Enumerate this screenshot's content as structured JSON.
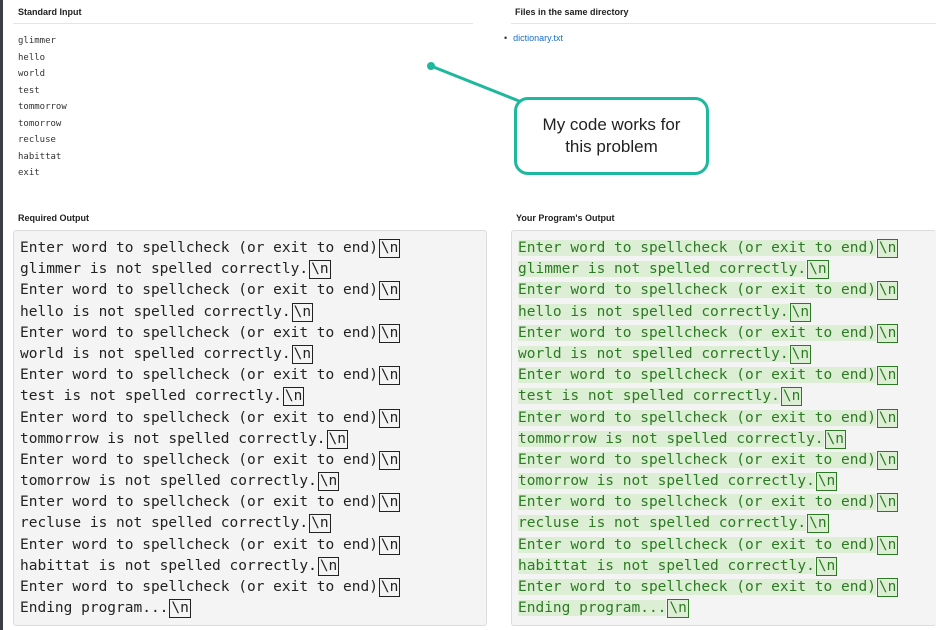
{
  "standard_input": {
    "title": "Standard Input",
    "lines": [
      "glimmer",
      "hello",
      "world",
      "test",
      "tommorrow",
      "tomorrow",
      "recluse",
      "habittat",
      "exit"
    ]
  },
  "files": {
    "title": "Files in the same directory",
    "items": [
      "dictionary.txt"
    ]
  },
  "annotation": {
    "text_line1": "My code works for",
    "text_line2": "this problem",
    "color": "#1db89e"
  },
  "required_output": {
    "title": "Required Output",
    "newline_marker": "\\n",
    "lines": [
      "Enter word to spellcheck (or exit to end)",
      "glimmer is not spelled correctly.",
      "Enter word to spellcheck (or exit to end)",
      "hello is not spelled correctly.",
      "Enter word to spellcheck (or exit to end)",
      "world is not spelled correctly.",
      "Enter word to spellcheck (or exit to end)",
      "test is not spelled correctly.",
      "Enter word to spellcheck (or exit to end)",
      "tommorrow is not spelled correctly.",
      "Enter word to spellcheck (or exit to end)",
      "tomorrow is not spelled correctly.",
      "Enter word to spellcheck (or exit to end)",
      "recluse is not spelled correctly.",
      "Enter word to spellcheck (or exit to end)",
      "habittat is not spelled correctly.",
      "Enter word to spellcheck (or exit to end)",
      "Ending program..."
    ]
  },
  "program_output": {
    "title": "Your Program's Output",
    "newline_marker": "\\n",
    "match_color": "#dcefd4",
    "lines": [
      "Enter word to spellcheck (or exit to end)",
      "glimmer is not spelled correctly.",
      "Enter word to spellcheck (or exit to end)",
      "hello is not spelled correctly.",
      "Enter word to spellcheck (or exit to end)",
      "world is not spelled correctly.",
      "Enter word to spellcheck (or exit to end)",
      "test is not spelled correctly.",
      "Enter word to spellcheck (or exit to end)",
      "tommorrow is not spelled correctly.",
      "Enter word to spellcheck (or exit to end)",
      "tomorrow is not spelled correctly.",
      "Enter word to spellcheck (or exit to end)",
      "recluse is not spelled correctly.",
      "Enter word to spellcheck (or exit to end)",
      "habittat is not spelled correctly.",
      "Enter word to spellcheck (or exit to end)",
      "Ending program..."
    ]
  }
}
